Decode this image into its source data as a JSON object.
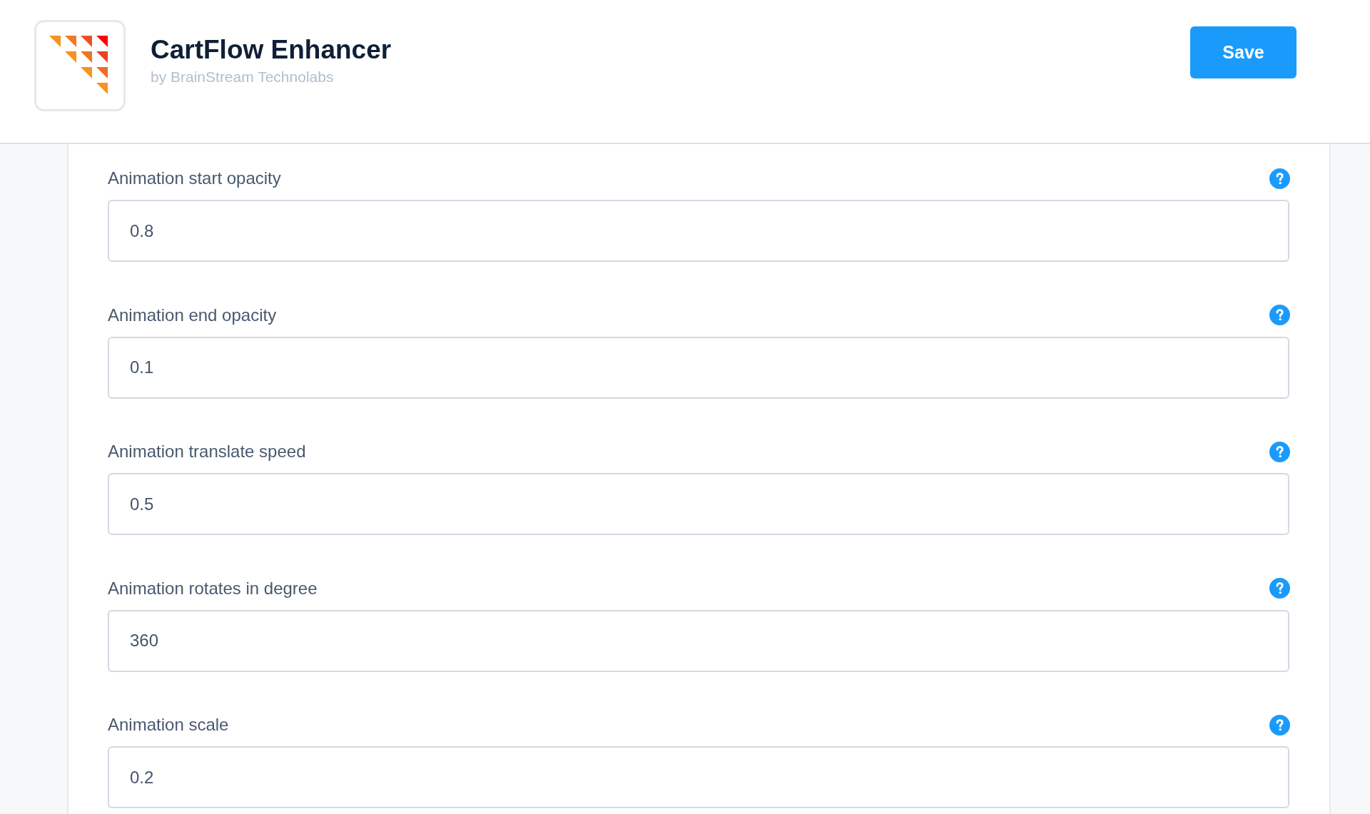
{
  "app": {
    "name": "CartFlow Enhancer",
    "vendor": "by BrainStream Technolabs"
  },
  "save_button": "Save",
  "fields": [
    {
      "label": "Animation start opacity",
      "value": "0.8"
    },
    {
      "label": "Animation end opacity",
      "value": "0.1"
    },
    {
      "label": "Animation translate speed",
      "value": "0.5"
    },
    {
      "label": "Animation rotates in degree",
      "value": "360"
    },
    {
      "label": "Animation scale",
      "value": "0.2"
    }
  ]
}
